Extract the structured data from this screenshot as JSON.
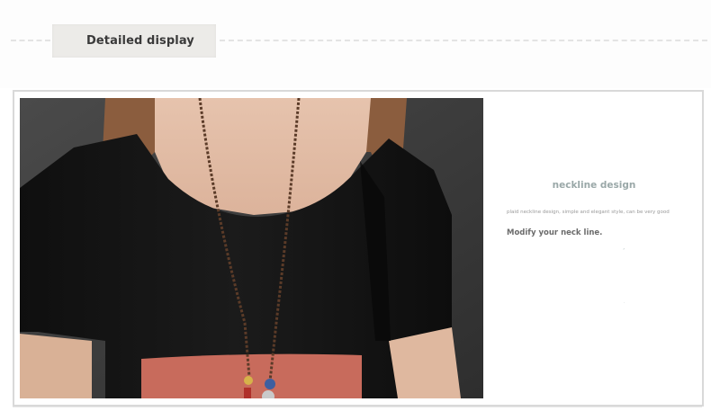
{
  "section": {
    "label": "Detailed display"
  },
  "feature": {
    "title": "neckline design",
    "description": "plaid neckline design, simple and elegant style, can be very good",
    "tagline": "Modify your neck line."
  },
  "colors": {
    "label_bg": "#ecebe8",
    "title_color": "#9aa8a8",
    "shirt_black": "#141414",
    "shirt_coral": "#c66a5a",
    "backdrop": "#3b3b3b",
    "hair": "#8a5a3a",
    "skin": "#e9c9b4"
  },
  "image": {
    "subject": "model wearing black and coral short-sleeve top with beaded cord necklace"
  }
}
